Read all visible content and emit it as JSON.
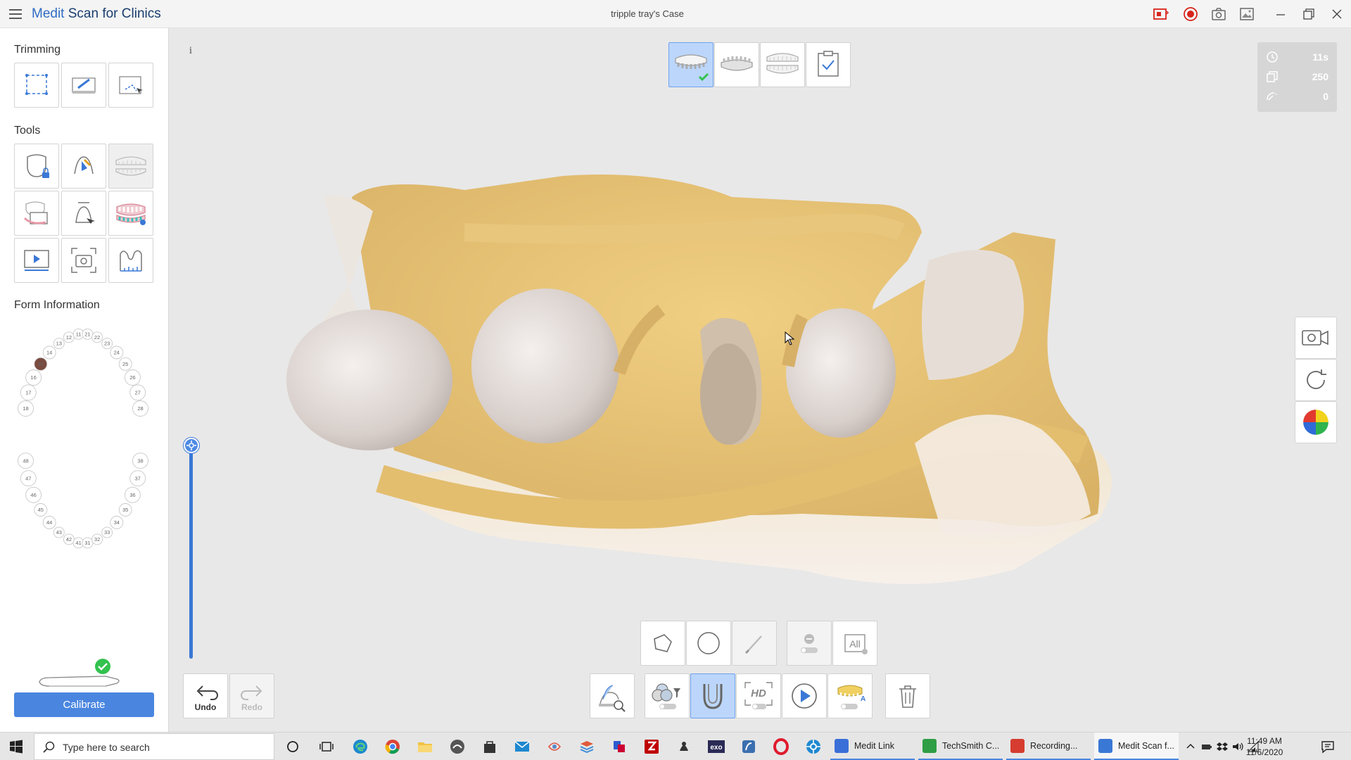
{
  "window": {
    "app_title_brand": "Medit",
    "app_title_rest": " Scan for Clinics",
    "case_title": "tripple tray's Case"
  },
  "left_panel": {
    "trimming_title": "Trimming",
    "tools_title": "Tools",
    "form_info_title": "Form Information",
    "calibrate_label": "Calibrate",
    "selected_tooth": "15",
    "teeth": {
      "upper": [
        "18",
        "17",
        "16",
        "15",
        "14",
        "13",
        "12",
        "11",
        "21",
        "22",
        "23",
        "24",
        "25",
        "26",
        "27",
        "28"
      ],
      "lower": [
        "48",
        "47",
        "46",
        "45",
        "44",
        "43",
        "42",
        "41",
        "31",
        "32",
        "33",
        "34",
        "35",
        "36",
        "37",
        "38"
      ]
    }
  },
  "stats": {
    "time": "11s",
    "frames": "250",
    "third": "0"
  },
  "bottom_toolbar": {
    "undo_label": "Undo",
    "redo_label": "Redo"
  },
  "taskbar": {
    "search_placeholder": "Type here to search",
    "apps": [
      {
        "label": "Medit Link",
        "color": "#3a6fd8"
      },
      {
        "label": "TechSmith C...",
        "color": "#2f9e44"
      },
      {
        "label": "Recording...",
        "color": "#d63c2f"
      },
      {
        "label": "Medit Scan f...",
        "color": "#3a78d6"
      }
    ],
    "time": "11:49 AM",
    "date": "11/6/2020"
  },
  "colors": {
    "accent": "#4a86e0",
    "success": "#33c24e",
    "active_stage": "#bcd6fb",
    "record": "#d8241c"
  }
}
